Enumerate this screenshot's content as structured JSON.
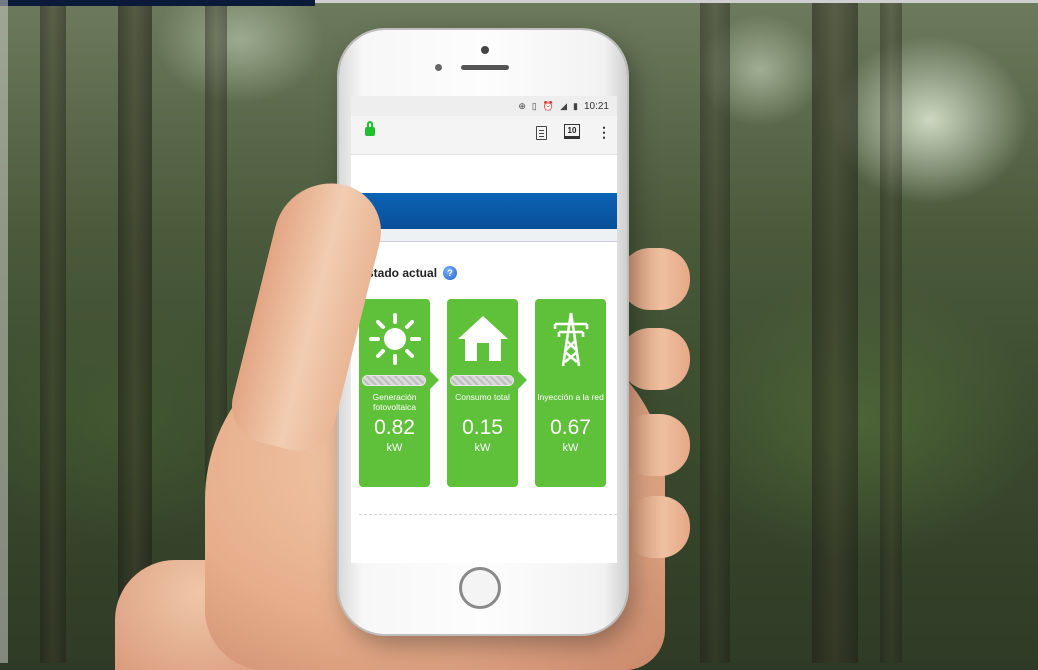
{
  "status_bar": {
    "time": "10:21"
  },
  "browser": {
    "tabs_count": "10"
  },
  "page": {
    "section_title": "Estado actual",
    "help_glyph": "?"
  },
  "cards": [
    {
      "icon": "sun-icon",
      "label_line1": "Generación",
      "label_line2": "fotovoltaica",
      "value": "0.82",
      "unit": "kW"
    },
    {
      "icon": "house-icon",
      "label_line1": "Consumo total",
      "label_line2": "",
      "value": "0.15",
      "unit": "kW"
    },
    {
      "icon": "power-tower-icon",
      "label_line1": "Inyección a la red",
      "label_line2": "",
      "value": "0.67",
      "unit": "kW"
    }
  ],
  "colors": {
    "card_green": "#5fc03a",
    "header_blue": "#0b63b5",
    "lock_green": "#1fbf2e"
  }
}
